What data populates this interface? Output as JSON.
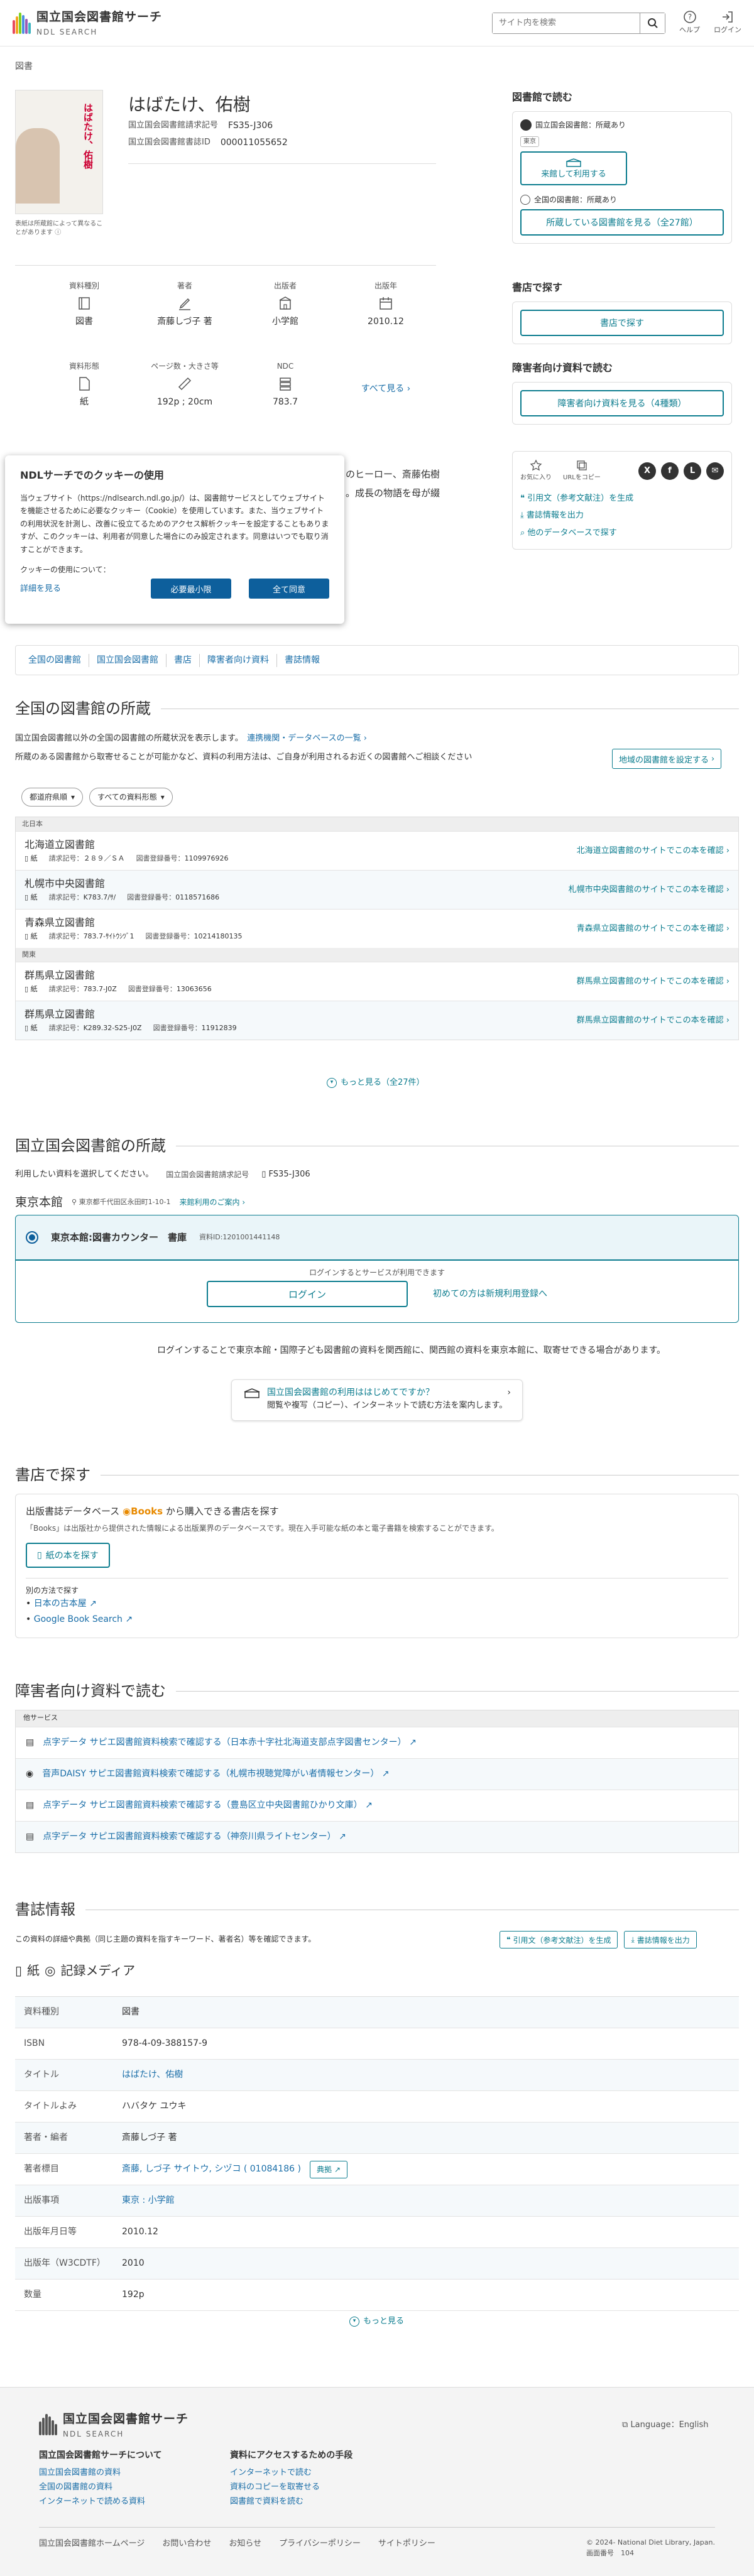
{
  "header": {
    "logo_title": "国立国会図書館サーチ",
    "logo_sub": "NDL SEARCH",
    "search_placeholder": "サイト内を検索",
    "help": "ヘルプ",
    "login": "ログイン"
  },
  "breadcrumb": "図書",
  "book": {
    "title": "はばたけ、佑樹",
    "image_note": "表紙は所蔵館によって異なることがあります",
    "cover_title": "はばたけ、佑樹",
    "ids": [
      {
        "k": "国立国会図書館請求記号",
        "v": "FS35-J306"
      },
      {
        "k": "国立国会図書館書誌ID",
        "v": "000011055652"
      }
    ],
    "meta": [
      {
        "k": "資料種別",
        "v": "図書",
        "icon": "book-icon"
      },
      {
        "k": "著者",
        "v": "斎藤しづ子 著",
        "icon": "pen-icon"
      },
      {
        "k": "出版者",
        "v": "小学館",
        "icon": "building-icon"
      },
      {
        "k": "出版年",
        "v": "2010.12",
        "icon": "calendar-icon"
      },
      {
        "k": "資料形態",
        "v": "紙",
        "icon": "paper-icon"
      },
      {
        "k": "ページ数・大きさ等",
        "v": "192p ; 20cm",
        "icon": "ruler-icon"
      },
      {
        "k": "NDC",
        "v": "783.7",
        "icon": "ndc-icon"
      }
    ],
    "see_all": "すべて見る"
  },
  "right": {
    "read_h": "図書館で読む",
    "ndl_holding": "国立国会図書館：所蔵あり",
    "tokyo_tag": "東京",
    "visit_btn": "来館して利用する",
    "all_holding": "全国の図書館：所蔵あり",
    "holding_btn": "所蔵している図書館を見る（全27館）",
    "store_h": "書店で探す",
    "store_btn": "書店で探す",
    "dis_h": "障害者向け資料で読む",
    "dis_btn": "障害者向け資料を見る（4種類）",
    "fav": "お気に入り",
    "urlcopy": "URLをコピー",
    "social": [
      "X",
      "f",
      "L",
      "✉"
    ],
    "links": [
      "引用文（参考文献注）を生成",
      "書誌情報を出力",
      "他のデータベースで探す"
    ]
  },
  "cookie": {
    "title": "NDLサーチでのクッキーの使用",
    "body": "当ウェブサイト（https://ndlsearch.ndl.go.jp/）は、図書館サービスとしてウェブサイトを機能させるために必要なクッキー（Cookie）を使用しています。また、当ウェブサイトの利用状況を計測し、改善に役立てるためのアクセス解析クッキーを設定することもありますが、このクッキーは、利用者が同意した場合にのみ設定されます。同意はいつでも取り消すことができます。",
    "about": "クッキーの使用について：",
    "detail": "詳細を見る",
    "min_btn": "必要最小限",
    "agree_btn": "全て同意"
  },
  "behind_text": [
    "のヒーロー、斎藤佑樹",
    "。成長の物語を母が綴"
  ],
  "section_nav": [
    "全国の図書館",
    "国立国会図書館",
    "書店",
    "障害者向け資料",
    "書誌情報"
  ],
  "national": {
    "h": "全国の図書館の所蔵",
    "desc1": "国立国会図書館以外の全国の図書館の所蔵状況を表示します。",
    "link1": "連携機関・データベースの一覧",
    "desc2": "所蔵のある図書館から取寄せることが可能かなど、資料の利用方法は、ご自身が利用されるお近くの図書館へご相談ください",
    "region_btn": "地域の図書館を設定する",
    "filter1": "都道府県順",
    "filter2": "すべての資料形態",
    "groups": [
      {
        "region": "北日本",
        "libs": [
          {
            "name": "北海道立図書館",
            "type": "紙",
            "call_k": "請求記号：",
            "call": "２８９／ＳＡ",
            "reg_k": "図書登録番号：",
            "reg": "1109976926",
            "link": "北海道立図書館のサイトでこの本を確認"
          },
          {
            "name": "札幌市中央図書館",
            "type": "紙",
            "call_k": "請求記号：",
            "call": "K783.7/ｻ/",
            "reg_k": "図書登録番号：",
            "reg": "0118571686",
            "link": "札幌市中央図書館のサイトでこの本を確認"
          },
          {
            "name": "青森県立図書館",
            "type": "紙",
            "call_k": "請求記号：",
            "call": "783.7-ｻｲﾄｳｼﾂﾞ1",
            "reg_k": "図書登録番号：",
            "reg": "10214180135",
            "link": "青森県立図書館のサイトでこの本を確認"
          }
        ]
      },
      {
        "region": "関東",
        "libs": [
          {
            "name": "群馬県立図書館",
            "type": "紙",
            "call_k": "請求記号：",
            "call": "783.7-J0Z",
            "reg_k": "図書登録番号：",
            "reg": "13063656",
            "link": "群馬県立図書館のサイトでこの本を確認"
          },
          {
            "name": "群馬県立図書館",
            "type": "紙",
            "call_k": "請求記号：",
            "call": "K289.32-S25-J0Z",
            "reg_k": "図書登録番号：",
            "reg": "11912839",
            "link": "群馬県立図書館のサイトでこの本を確認"
          }
        ]
      }
    ],
    "more": "もっと見る（全27件）"
  },
  "ndl": {
    "h": "国立国会図書館の所蔵",
    "select": "利用したい資料を選択してください。",
    "call_k": "国立国会図書館請求記号",
    "call": "FS35-J306",
    "branch": "東京本館",
    "address": "東京都千代田区永田町1-10-1",
    "visit_guide": "来館利用のご案内",
    "item_title": "東京本館:図書カウンター　書庫",
    "item_id": "資料ID:1201001441148",
    "login_note": "ログインするとサービスが利用できます",
    "login_btn": "ログイン",
    "register": "初めての方は新規利用登録へ",
    "note": "ログインすることで東京本館・国際子ども図書館の資料を関西館に、関西館の資料を東京本館に、取寄せできる場合があります。",
    "info_title": "国立国会図書館の利用ははじめてですか？",
    "info_sub": "閲覧や複写（コピー）、インターネットで読む方法を案内します。"
  },
  "store": {
    "h": "書店で探す",
    "db_pre": "出版書誌データベース",
    "db_name": "Books",
    "db_post": "から購入できる書店を探す",
    "db_desc": "「Books」は出版社から提供された情報による出版業界のデータベースです。現在入手可能な紙の本と電子書籍を検索することができます。",
    "btn": "紙の本を探す",
    "other": "別の方法で探す",
    "links": [
      "日本の古本屋",
      "Google Book Search"
    ]
  },
  "disability": {
    "h": "障害者向け資料で読む",
    "head": "他サービス",
    "rows": [
      "点字データ サピエ図書館資料検索で確認する（日本赤十字社北海道支部点字図書センター）",
      "音声DAISY サピエ図書館資料検索で確認する（札幌市視聴覚障がい者情報センター）",
      "点字データ サピエ図書館資料検索で確認する（豊島区立中央図書館ひかり文庫）",
      "点字データ サピエ図書館資料検索で確認する（神奈川県ライトセンター）"
    ]
  },
  "biblio": {
    "h": "書誌情報",
    "desc": "この資料の詳細や典拠（同じ主題の資料を指すキーワード、著者名）等を確認できます。",
    "cite_btn": "引用文（参考文献注）を生成",
    "export_btn": "書誌情報を出力",
    "media1": "紙",
    "media2": "記録メディア",
    "rows": [
      {
        "k": "資料種別",
        "v": "図書"
      },
      {
        "k": "ISBN",
        "v": "978-4-09-388157-9"
      },
      {
        "k": "タイトル",
        "v": "はばたけ、佑樹"
      },
      {
        "k": "タイトルよみ",
        "v": "ハバタケ ユウキ"
      },
      {
        "k": "著者・編者",
        "v": "斎藤しづ子 著"
      },
      {
        "k": "著者標目",
        "v": "斎藤, しづ子 サイトウ, シヅコ ( 01084186 )"
      },
      {
        "k": "出版事項",
        "v": "東京 : 小学館"
      },
      {
        "k": "出版年月日等",
        "v": "2010.12"
      },
      {
        "k": "出版年（W3CDTF）",
        "v": "2010"
      },
      {
        "k": "数量",
        "v": "192p"
      }
    ],
    "authority_btn": "典拠",
    "more": "もっと見る"
  },
  "footer": {
    "logo_title": "国立国会図書館サーチ",
    "logo_sub": "NDL SEARCH",
    "lang": "Language：English",
    "col1_h": "国立国会図書館サーチについて",
    "col1": [
      "国立国会図書館の資料",
      "全国の図書館の資料",
      "インターネットで読める資料"
    ],
    "col2_h": "資料にアクセスするための手段",
    "col2": [
      "インターネットで読む",
      "資料のコピーを取寄せる",
      "図書館で資料を読む"
    ],
    "bottom": [
      "国立国会図書館ホームページ",
      "お問い合わせ",
      "お知らせ",
      "プライバシーポリシー",
      "サイトポリシー"
    ],
    "copyright": "© 2024- National Diet Library, Japan.",
    "screen_k": "画面番号",
    "screen_v": "104"
  },
  "colors": {
    "accent": "#0d7d8f",
    "link": "#1a6ea8",
    "button_dark": "#0d5f9c"
  }
}
